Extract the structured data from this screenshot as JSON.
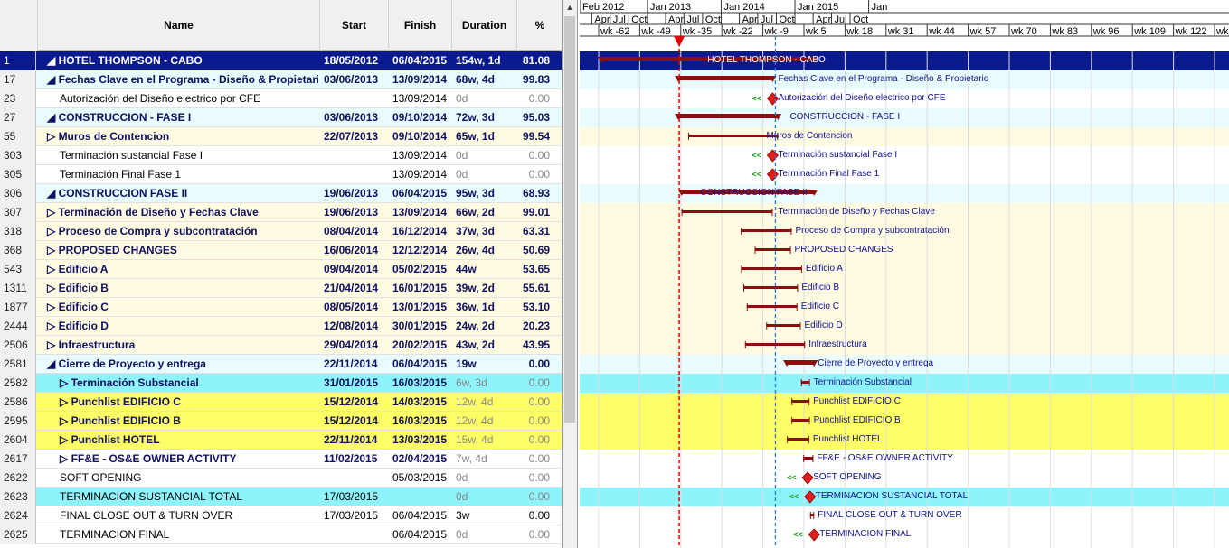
{
  "columns": {
    "name": "Name",
    "start": "Start",
    "finish": "Finish",
    "duration": "Duration",
    "pct": "%"
  },
  "timeline": {
    "years": [
      {
        "label": "Feb 2012"
      },
      {
        "label": "Jan 2013"
      },
      {
        "label": "Jan 2014"
      },
      {
        "label": "Jan 2015"
      },
      {
        "label": "Jan"
      }
    ],
    "months": [
      "Apr",
      "Jul",
      "Oct",
      "Apr",
      "Jul",
      "Oct",
      "Apr",
      "Jul",
      "Oct",
      "Apr",
      "Jul",
      "Oct"
    ],
    "weeks": [
      "wk -62",
      "wk -49",
      "wk -35",
      "wk -22",
      "wk -9",
      "wk 5",
      "wk 18",
      "wk 31",
      "wk 44",
      "wk 57",
      "wk 70",
      "wk 83",
      "wk 96",
      "wk 109",
      "wk 122",
      "wk 1"
    ]
  },
  "rows": [
    {
      "id": "1",
      "name": "◢ HOTEL THOMPSON - CABO",
      "start": "18/05/2012",
      "finish": "06/04/2015",
      "duration": "154w, 1d",
      "pct": "81.08",
      "style": "navy",
      "bold": true,
      "indent": 0,
      "bar_label": "HOTEL THOMPSON - CABO"
    },
    {
      "id": "17",
      "name": "◢ Fechas Clave en el Programa - Diseño & Propietario",
      "start": "03/06/2013",
      "finish": "13/09/2014",
      "duration": "68w, 4d",
      "pct": "99.83",
      "style": "lblue",
      "bold": true,
      "indent": 1,
      "bar_label": "Fechas Clave en el Programa - Diseño & Propietario"
    },
    {
      "id": "23",
      "name": "Autorización del Diseño electrico por CFE",
      "start": "",
      "finish": "13/09/2014",
      "duration": "0d",
      "pct": "0.00",
      "style": "white",
      "bold": false,
      "indent": 2,
      "bar_label": "Autorización del Diseño electrico por CFE",
      "gray": true
    },
    {
      "id": "27",
      "name": "◢ CONSTRUCCION - FASE I",
      "start": "03/06/2013",
      "finish": "09/10/2014",
      "duration": "72w, 3d",
      "pct": "95.03",
      "style": "lblue",
      "bold": true,
      "indent": 1,
      "bar_label": "CONSTRUCCION - FASE I"
    },
    {
      "id": "55",
      "name": "▷ Muros de Contencion",
      "start": "22/07/2013",
      "finish": "09/10/2014",
      "duration": "65w, 1d",
      "pct": "99.54",
      "style": "cream",
      "bold": true,
      "indent": 1,
      "bar_label": "Muros de Contencion"
    },
    {
      "id": "303",
      "name": "Terminación sustancial Fase I",
      "start": "",
      "finish": "13/09/2014",
      "duration": "0d",
      "pct": "0.00",
      "style": "white",
      "bold": false,
      "indent": 2,
      "bar_label": "Terminación sustancial Fase I",
      "gray": true
    },
    {
      "id": "305",
      "name": "Terminación Final Fase 1",
      "start": "",
      "finish": "13/09/2014",
      "duration": "0d",
      "pct": "0.00",
      "style": "white",
      "bold": false,
      "indent": 2,
      "bar_label": "Terminación Final Fase 1",
      "gray": true
    },
    {
      "id": "306",
      "name": "◢ CONSTRUCCION FASE II",
      "start": "19/06/2013",
      "finish": "06/04/2015",
      "duration": "95w, 3d",
      "pct": "68.93",
      "style": "lblue",
      "bold": true,
      "indent": 1,
      "bar_label": "CONSTRUCCION FASE II"
    },
    {
      "id": "307",
      "name": "▷ Terminación de Diseño y Fechas Clave",
      "start": "19/06/2013",
      "finish": "13/09/2014",
      "duration": "66w, 2d",
      "pct": "99.01",
      "style": "cream",
      "bold": true,
      "indent": 1,
      "bar_label": "Terminación de Diseño y Fechas Clave"
    },
    {
      "id": "318",
      "name": "▷ Proceso de Compra y subcontratación",
      "start": "08/04/2014",
      "finish": "16/12/2014",
      "duration": "37w, 3d",
      "pct": "63.31",
      "style": "cream",
      "bold": true,
      "indent": 1,
      "bar_label": "Proceso de Compra y subcontratación"
    },
    {
      "id": "368",
      "name": "▷ PROPOSED CHANGES",
      "start": "16/06/2014",
      "finish": "12/12/2014",
      "duration": "26w, 4d",
      "pct": "50.69",
      "style": "cream",
      "bold": true,
      "indent": 1,
      "bar_label": "PROPOSED CHANGES"
    },
    {
      "id": "543",
      "name": "▷ Edificio A",
      "start": "09/04/2014",
      "finish": "05/02/2015",
      "duration": "44w",
      "pct": "53.65",
      "style": "cream",
      "bold": true,
      "indent": 1,
      "bar_label": "Edificio A"
    },
    {
      "id": "1311",
      "name": "▷ Edificio B",
      "start": "21/04/2014",
      "finish": "16/01/2015",
      "duration": "39w, 2d",
      "pct": "55.61",
      "style": "cream",
      "bold": true,
      "indent": 1,
      "bar_label": "Edificio B"
    },
    {
      "id": "1877",
      "name": "▷ Edificio C",
      "start": "08/05/2014",
      "finish": "13/01/2015",
      "duration": "36w, 1d",
      "pct": "53.10",
      "style": "cream",
      "bold": true,
      "indent": 1,
      "bar_label": "Edificio C"
    },
    {
      "id": "2444",
      "name": "▷ Edificio D",
      "start": "12/08/2014",
      "finish": "30/01/2015",
      "duration": "24w, 2d",
      "pct": "20.23",
      "style": "cream",
      "bold": true,
      "indent": 1,
      "bar_label": "Edificio D"
    },
    {
      "id": "2506",
      "name": "▷ Infraestructura",
      "start": "29/04/2014",
      "finish": "20/02/2015",
      "duration": "43w, 2d",
      "pct": "43.95",
      "style": "cream",
      "bold": true,
      "indent": 1,
      "bar_label": "Infraestructura"
    },
    {
      "id": "2581",
      "name": "◢ Cierre de Proyecto y entrega",
      "start": "22/11/2014",
      "finish": "06/04/2015",
      "duration": "19w",
      "pct": "0.00",
      "style": "lblue",
      "bold": true,
      "indent": 1,
      "bar_label": "Cierre de Proyecto y entrega"
    },
    {
      "id": "2582",
      "name": "▷ Terminación Substancial",
      "start": "31/01/2015",
      "finish": "16/03/2015",
      "duration": "6w, 3d",
      "pct": "0.00",
      "style": "cyan",
      "bold": true,
      "indent": 2,
      "bar_label": "Terminación Substancial",
      "graydur": true
    },
    {
      "id": "2586",
      "name": "▷ Punchlist EDIFICIO C",
      "start": "15/12/2014",
      "finish": "14/03/2015",
      "duration": "12w, 4d",
      "pct": "0.00",
      "style": "yellow",
      "bold": true,
      "indent": 2,
      "bar_label": "Punchlist EDIFICIO C",
      "graydur": true
    },
    {
      "id": "2595",
      "name": "▷ Punchlist EDIFICIO B",
      "start": "15/12/2014",
      "finish": "16/03/2015",
      "duration": "12w, 4d",
      "pct": "0.00",
      "style": "yellow",
      "bold": true,
      "indent": 2,
      "bar_label": "Punchlist EDIFICIO B",
      "graydur": true
    },
    {
      "id": "2604",
      "name": "▷ Punchlist HOTEL",
      "start": "22/11/2014",
      "finish": "13/03/2015",
      "duration": "15w, 4d",
      "pct": "0.00",
      "style": "yellow",
      "bold": true,
      "indent": 2,
      "bar_label": "Punchlist HOTEL",
      "graydur": true
    },
    {
      "id": "2617",
      "name": "▷ FF&E - OS&E OWNER ACTIVITY",
      "start": "11/02/2015",
      "finish": "02/04/2015",
      "duration": "7w, 4d",
      "pct": "0.00",
      "style": "white",
      "bold": true,
      "indent": 2,
      "bar_label": "FF&E - OS&E OWNER ACTIVITY",
      "graydur": true
    },
    {
      "id": "2622",
      "name": "SOFT OPENING",
      "start": "",
      "finish": "05/03/2015",
      "duration": "0d",
      "pct": "0.00",
      "style": "white",
      "bold": false,
      "indent": 2,
      "bar_label": "SOFT OPENING",
      "gray": true
    },
    {
      "id": "2623",
      "name": "TERMINACION SUSTANCIAL TOTAL",
      "start": "17/03/2015",
      "finish": "",
      "duration": "0d",
      "pct": "0.00",
      "style": "cyan",
      "bold": false,
      "indent": 2,
      "bar_label": "TERMINACION SUSTANCIAL TOTAL",
      "gray": true
    },
    {
      "id": "2624",
      "name": "FINAL CLOSE OUT & TURN OVER",
      "start": "17/03/2015",
      "finish": "06/04/2015",
      "duration": "3w",
      "pct": "0.00",
      "style": "white",
      "bold": false,
      "indent": 2,
      "bar_label": "FINAL CLOSE OUT & TURN OVER"
    },
    {
      "id": "2625",
      "name": "TERMINACION FINAL",
      "start": "",
      "finish": "06/04/2015",
      "duration": "0d",
      "pct": "0.00",
      "style": "white",
      "bold": false,
      "indent": 2,
      "bar_label": "TERMINACION FINAL",
      "gray": true
    }
  ],
  "colors": {
    "navy": "#0a1a8c",
    "bar": "#8b0f0f",
    "milestone": "#e01e1e",
    "today_line": "#e00000",
    "status_line": "#2a7ad8"
  },
  "milestone_marker": "<<"
}
